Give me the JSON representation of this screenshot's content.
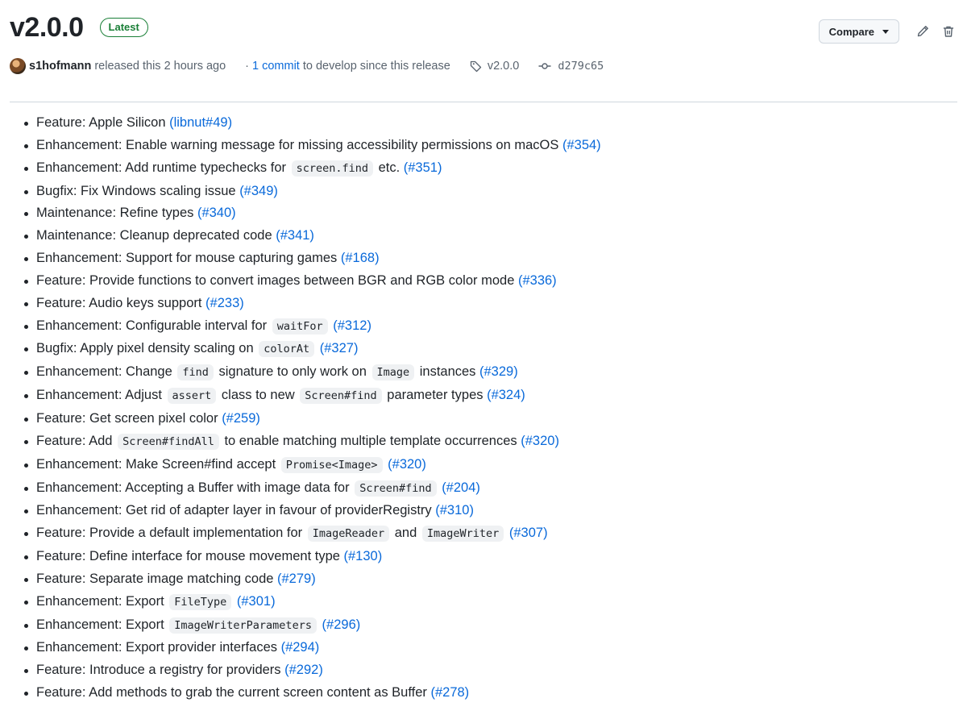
{
  "release": {
    "title": "v2.0.0",
    "badge": "Latest",
    "compare_label": "Compare",
    "author": "s1hofmann",
    "released_text": "released this 2 hours ago",
    "separator": "·",
    "commit_link": "1 commit",
    "since_text": "to develop since this release",
    "tag": "v2.0.0",
    "commit_sha": "d279c65"
  },
  "icons": {
    "edit": "pencil-icon",
    "delete": "trash-icon",
    "tag": "tag-icon",
    "commit": "git-commit-icon",
    "dropdown": "caret-down-icon"
  },
  "colors": {
    "link": "#0969da",
    "badge": "#1a7f37",
    "text": "#1f2328",
    "muted": "#59636e"
  },
  "notes": [
    [
      {
        "t": "Feature: Apple Silicon "
      },
      {
        "ref": "(libnut#49)"
      }
    ],
    [
      {
        "t": "Enhancement: Enable warning message for missing accessibility permissions on macOS "
      },
      {
        "ref": "(#354)"
      }
    ],
    [
      {
        "t": "Enhancement: Add runtime typechecks for "
      },
      {
        "code": "screen.find"
      },
      {
        "t": " etc. "
      },
      {
        "ref": "(#351)"
      }
    ],
    [
      {
        "t": "Bugfix: Fix Windows scaling issue "
      },
      {
        "ref": "(#349)"
      }
    ],
    [
      {
        "t": "Maintenance: Refine types "
      },
      {
        "ref": "(#340)"
      }
    ],
    [
      {
        "t": "Maintenance: Cleanup deprecated code "
      },
      {
        "ref": "(#341)"
      }
    ],
    [
      {
        "t": "Enhancement: Support for mouse capturing games "
      },
      {
        "ref": "(#168)"
      }
    ],
    [
      {
        "t": "Feature: Provide functions to convert images between BGR and RGB color mode "
      },
      {
        "ref": "(#336)"
      }
    ],
    [
      {
        "t": "Feature: Audio keys support "
      },
      {
        "ref": "(#233)"
      }
    ],
    [
      {
        "t": "Enhancement: Configurable interval for "
      },
      {
        "code": "waitFor"
      },
      {
        "t": " "
      },
      {
        "ref": "(#312)"
      }
    ],
    [
      {
        "t": "Bugfix: Apply pixel density scaling on "
      },
      {
        "code": "colorAt"
      },
      {
        "t": " "
      },
      {
        "ref": "(#327)"
      }
    ],
    [
      {
        "t": "Enhancement: Change "
      },
      {
        "code": "find"
      },
      {
        "t": " signature to only work on "
      },
      {
        "code": "Image"
      },
      {
        "t": " instances "
      },
      {
        "ref": "(#329)"
      }
    ],
    [
      {
        "t": "Enhancement: Adjust "
      },
      {
        "code": "assert"
      },
      {
        "t": " class to new "
      },
      {
        "code": "Screen#find"
      },
      {
        "t": " parameter types "
      },
      {
        "ref": "(#324)"
      }
    ],
    [
      {
        "t": "Feature: Get screen pixel color "
      },
      {
        "ref": "(#259)"
      }
    ],
    [
      {
        "t": "Feature: Add "
      },
      {
        "code": "Screen#findAll"
      },
      {
        "t": " to enable matching multiple template occurrences "
      },
      {
        "ref": "(#320)"
      }
    ],
    [
      {
        "t": "Enhancement: Make Screen#find accept "
      },
      {
        "code": "Promise<Image>"
      },
      {
        "t": " "
      },
      {
        "ref": "(#320)"
      }
    ],
    [
      {
        "t": "Enhancement: Accepting a Buffer with image data for "
      },
      {
        "code": "Screen#find"
      },
      {
        "t": " "
      },
      {
        "ref": "(#204)"
      }
    ],
    [
      {
        "t": "Enhancement: Get rid of adapter layer in favour of providerRegistry "
      },
      {
        "ref": "(#310)"
      }
    ],
    [
      {
        "t": "Feature: Provide a default implementation for "
      },
      {
        "code": "ImageReader"
      },
      {
        "t": " and "
      },
      {
        "code": "ImageWriter"
      },
      {
        "t": " "
      },
      {
        "ref": "(#307)"
      }
    ],
    [
      {
        "t": "Feature: Define interface for mouse movement type "
      },
      {
        "ref": "(#130)"
      }
    ],
    [
      {
        "t": "Feature: Separate image matching code "
      },
      {
        "ref": "(#279)"
      }
    ],
    [
      {
        "t": "Enhancement: Export "
      },
      {
        "code": "FileType"
      },
      {
        "t": " "
      },
      {
        "ref": "(#301)"
      }
    ],
    [
      {
        "t": "Enhancement: Export "
      },
      {
        "code": "ImageWriterParameters"
      },
      {
        "t": " "
      },
      {
        "ref": "(#296)"
      }
    ],
    [
      {
        "t": "Enhancement: Export provider interfaces "
      },
      {
        "ref": "(#294)"
      }
    ],
    [
      {
        "t": "Feature: Introduce a registry for providers "
      },
      {
        "ref": "(#292)"
      }
    ],
    [
      {
        "t": "Feature: Add methods to grab the current screen content as Buffer "
      },
      {
        "ref": "(#278)"
      }
    ]
  ]
}
